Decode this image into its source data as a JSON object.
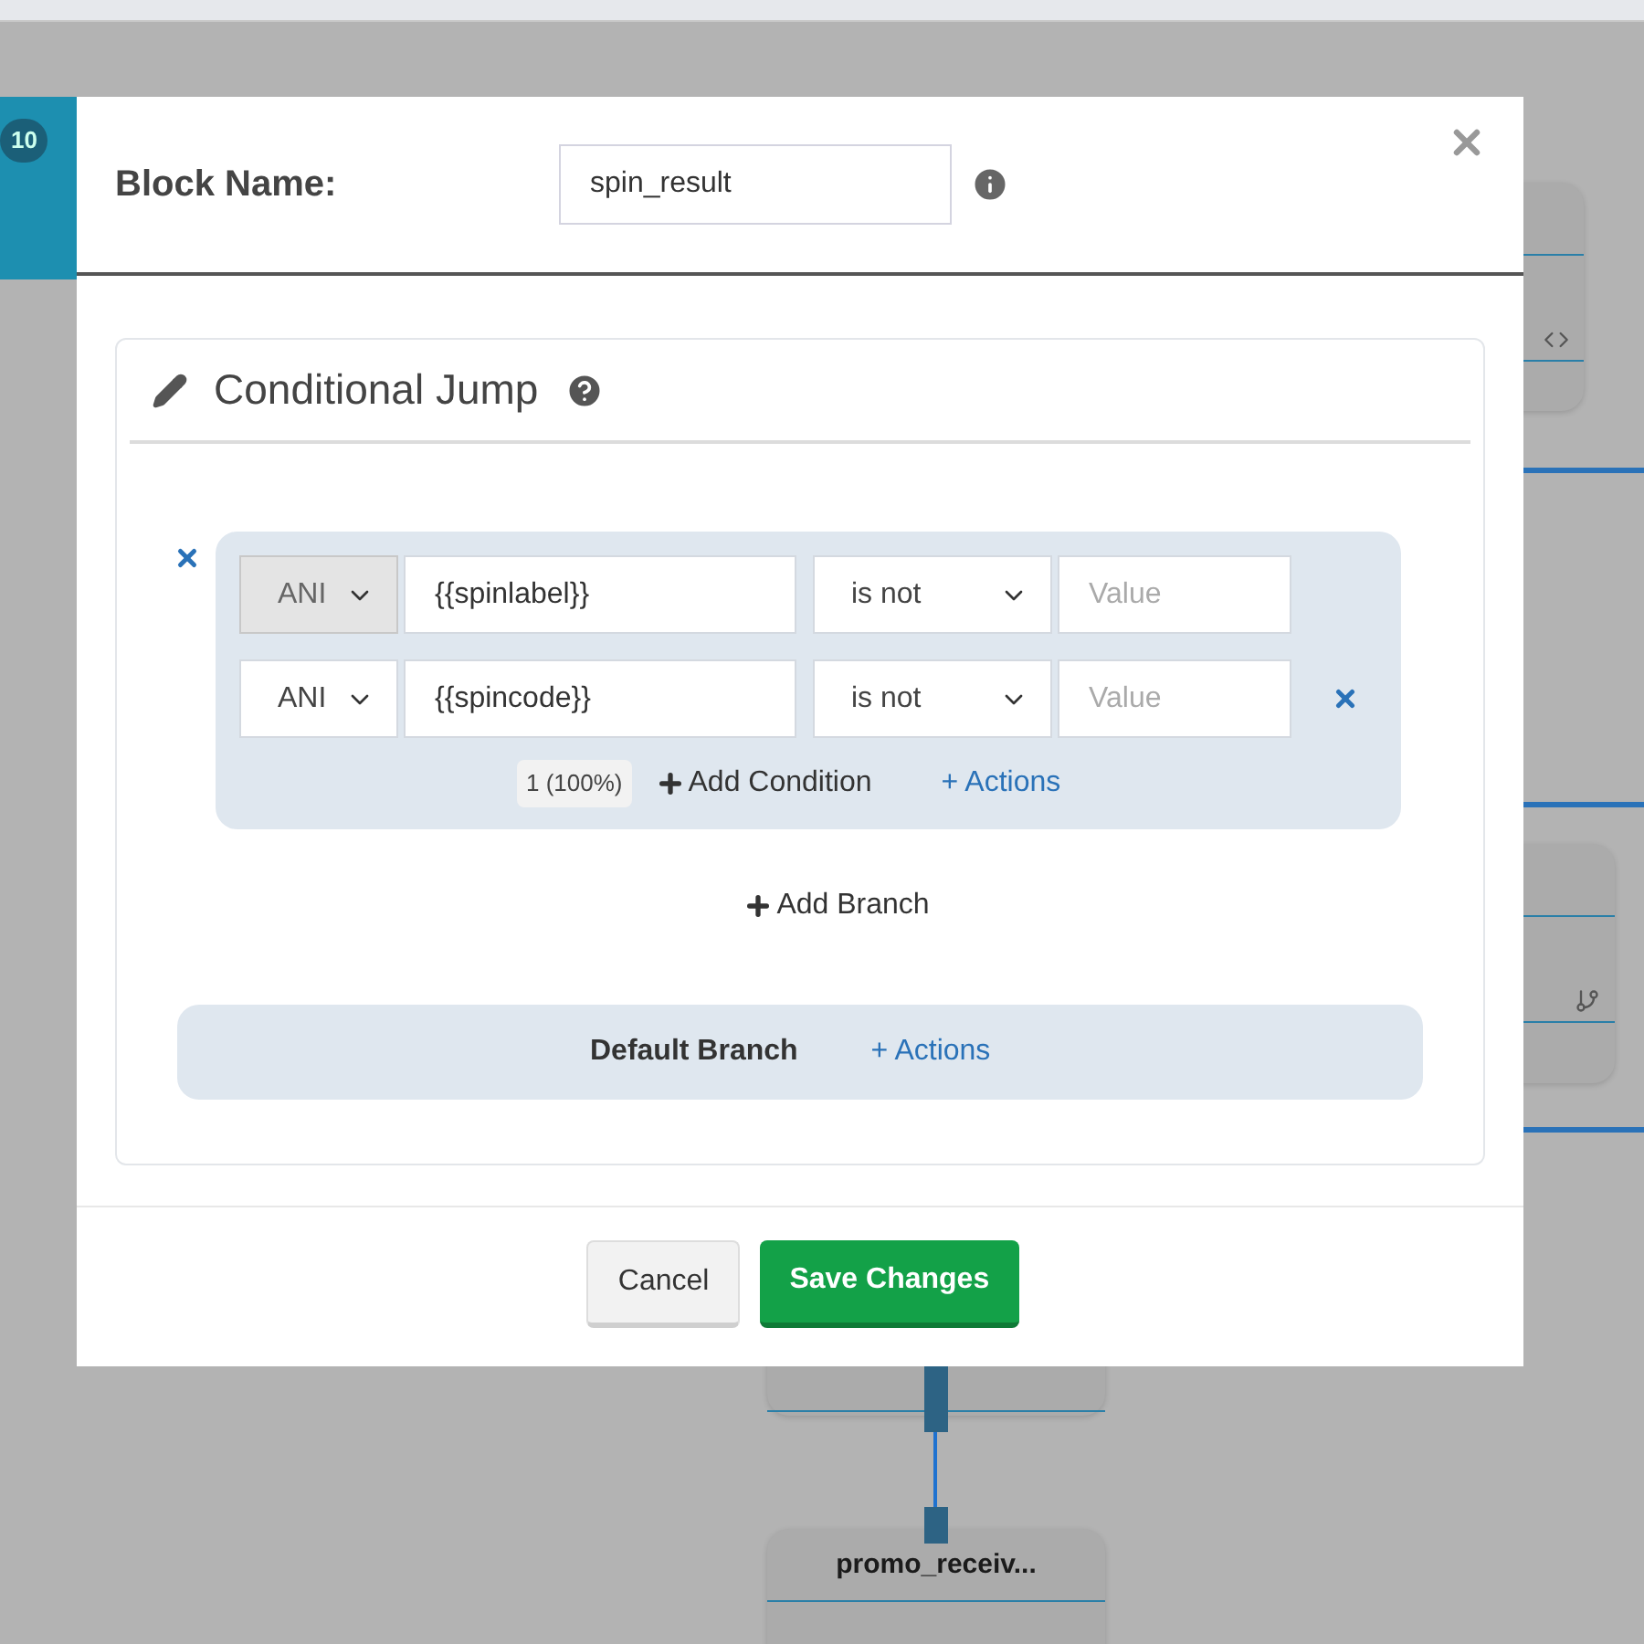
{
  "canvas": {
    "badge": "10",
    "nodes": [
      {
        "kind": "code"
      },
      {
        "kind": "branch"
      },
      {
        "kind": "plain"
      },
      {
        "kind": "plain",
        "title": "promo_receiv..."
      }
    ]
  },
  "dialog": {
    "name_label": "Block Name:",
    "name_value": "spin_result",
    "panel": {
      "title": "Conditional Jump",
      "branches": [
        {
          "conditions": [
            {
              "join": "ANI",
              "join_disabled": true,
              "variable": "{{spinlabel}}",
              "operator": "is not",
              "value_placeholder": "Value",
              "removable": false
            },
            {
              "join": "ANI",
              "join_disabled": false,
              "variable": "{{spincode}}",
              "operator": "is not",
              "value_placeholder": "Value",
              "removable": true
            }
          ],
          "share": "1 (100%)",
          "add_condition": "Add Condition",
          "actions": "+ Actions"
        }
      ],
      "add_branch": "Add Branch",
      "default_branch": {
        "label": "Default Branch",
        "actions": "+ Actions"
      }
    },
    "buttons": [
      {
        "label": "Cancel",
        "kind": "secondary"
      },
      {
        "label": "Save Changes",
        "kind": "primary"
      }
    ]
  }
}
